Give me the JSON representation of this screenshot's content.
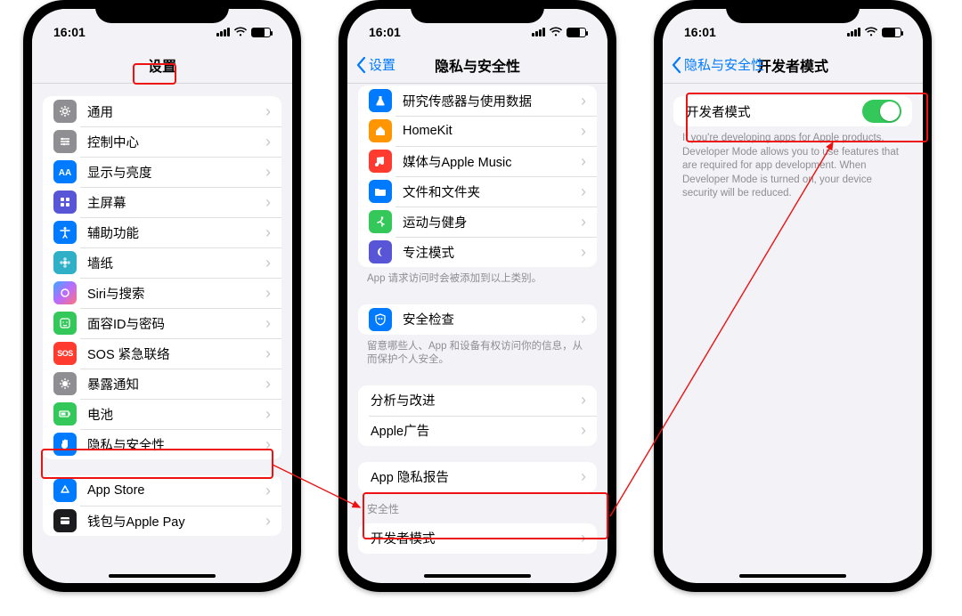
{
  "status": {
    "time": "16:01"
  },
  "phone1": {
    "title": "设置",
    "rows": [
      {
        "label": "通用",
        "color": "c-gray",
        "icon": "gear"
      },
      {
        "label": "控制中心",
        "color": "c-gray",
        "icon": "sliders"
      },
      {
        "label": "显示与亮度",
        "color": "c-blue",
        "icon": "AA"
      },
      {
        "label": "主屏幕",
        "color": "c-indigo",
        "icon": "grid"
      },
      {
        "label": "辅助功能",
        "color": "c-blue",
        "icon": "body"
      },
      {
        "label": "墙纸",
        "color": "c-teal",
        "icon": "flower"
      },
      {
        "label": "Siri与搜索",
        "color": "c-siri",
        "icon": "siri"
      },
      {
        "label": "面容ID与密码",
        "color": "c-green",
        "icon": "face"
      },
      {
        "label": "SOS 紧急联络",
        "color": "c-sos",
        "icon": "SOS"
      },
      {
        "label": "暴露通知",
        "color": "c-gray",
        "icon": "virus"
      },
      {
        "label": "电池",
        "color": "c-green",
        "icon": "battery"
      },
      {
        "label": "隐私与安全性",
        "color": "c-blue",
        "icon": "hand"
      }
    ],
    "rows2": [
      {
        "label": "App Store",
        "color": "c-blue",
        "icon": "appstore"
      },
      {
        "label": "钱包与Apple Pay",
        "color": "c-black",
        "icon": "wallet"
      }
    ]
  },
  "phone2": {
    "back": "设置",
    "title": "隐私与安全性",
    "group1": [
      {
        "label": "研究传感器与使用数据",
        "color": "c-blue",
        "icon": "flask"
      },
      {
        "label": "HomeKit",
        "color": "c-orange",
        "icon": "home"
      },
      {
        "label": "媒体与Apple Music",
        "color": "c-red",
        "icon": "music"
      },
      {
        "label": "文件和文件夹",
        "color": "c-blue",
        "icon": "folder"
      },
      {
        "label": "运动与健身",
        "color": "c-green",
        "icon": "run"
      },
      {
        "label": "专注模式",
        "color": "c-indigo",
        "icon": "moon"
      }
    ],
    "footer1": "App 请求访问时会被添加到以上类别。",
    "group2": [
      {
        "label": "安全检查",
        "color": "c-blue",
        "icon": "shield"
      }
    ],
    "footer2": "留意哪些人、App 和设备有权访问你的信息，从而保护个人安全。",
    "group3": [
      {
        "label": "分析与改进"
      },
      {
        "label": "Apple广告"
      }
    ],
    "group4": [
      {
        "label": "App 隐私报告"
      }
    ],
    "sec_header": "安全性",
    "group5": [
      {
        "label": "开发者模式"
      }
    ]
  },
  "phone3": {
    "back": "隐私与安全性",
    "title": "开发者模式",
    "row_label": "开发者模式",
    "desc": "If you're developing apps for Apple products, Developer Mode allows you to use features that are required for app development. When Developer Mode is turned on, your device security will be reduced."
  }
}
